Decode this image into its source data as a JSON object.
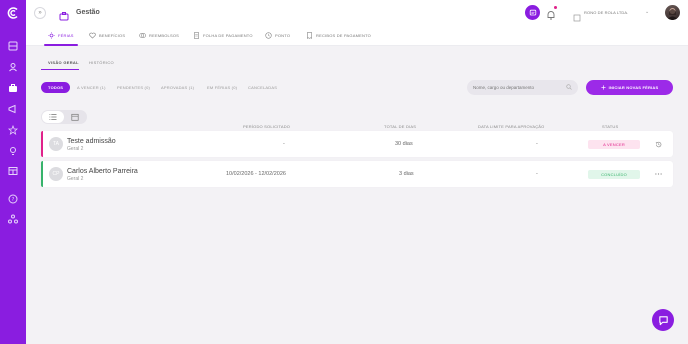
{
  "header": {
    "collapse_glyph": "»",
    "section_title": "Gestão",
    "company_name": "RONO DE ROLA LTDA.",
    "company_chevron": "⌄"
  },
  "tabs": [
    {
      "label": "FÉRIAS",
      "icon": "sun-icon"
    },
    {
      "label": "BENEFÍCIOS",
      "icon": "heart-hand-icon"
    },
    {
      "label": "REEMBOLSOS",
      "icon": "coins-icon"
    },
    {
      "label": "FOLHA DE PAGAMENTO",
      "icon": "document-icon"
    },
    {
      "label": "PONTO",
      "icon": "clock-icon"
    },
    {
      "label": "RECIBOS DE PAGAMENTO",
      "icon": "receipt-icon"
    }
  ],
  "subtabs": [
    {
      "label": "VISÃO GERAL"
    },
    {
      "label": "HISTÓRICO"
    }
  ],
  "filters": [
    {
      "label": "TODOS"
    },
    {
      "label": "A VENCER (1)"
    },
    {
      "label": "PENDENTES (0)"
    },
    {
      "label": "APROVADAS (1)"
    },
    {
      "label": "EM FÉRIAS (0)"
    },
    {
      "label": "CANCELADAS"
    }
  ],
  "search": {
    "placeholder": "Nome, cargo ou departamento"
  },
  "primary_button": {
    "label": "INICIAR NOVAS FÉRIAS",
    "icon": "plus-icon"
  },
  "columns": {
    "period": "PERÍODO SOLICITADO",
    "total": "TOTAL DE DIAS",
    "deadline": "DATA LIMITE PARA APROVAÇÃO",
    "status": "STATUS"
  },
  "rows": [
    {
      "initials": "TA",
      "name": "Teste admissão",
      "group": "Geral 2",
      "period": "-",
      "total": "30 dias",
      "deadline": "-",
      "status": "A VENCER",
      "status_color": "#e0218a",
      "marker_color": "#e0218a",
      "action_icon": "history-icon"
    },
    {
      "initials": "CP",
      "name": "Carlos Alberto Parreira",
      "group": "Geral 2",
      "period": "10/02/2026 - 12/02/2026",
      "total": "3 dias",
      "deadline": "-",
      "status": "CONCLUÍDO",
      "status_color": "#37b36b",
      "marker_color": "#37b36b",
      "action_icon": "more-icon"
    }
  ],
  "colors": {
    "accent": "#8a1de0",
    "warning": "#e0218a",
    "success": "#37b36b"
  }
}
